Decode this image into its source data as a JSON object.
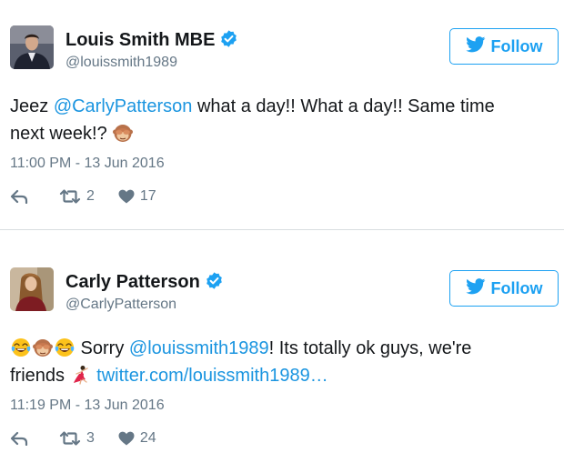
{
  "tweets": [
    {
      "author_name": "Louis Smith MBE",
      "handle": "@louissmith1989",
      "verified": true,
      "follow_label": "Follow",
      "body": {
        "prefix": "Jeez ",
        "mention": "@CarlyPatterson",
        "line1_rest": " what a day!! What a day!! Same time",
        "line2": "next week!? ",
        "emoji": "see-no-evil-monkey"
      },
      "timestamp": "11:00 PM - 13 Jun 2016",
      "retweets": "2",
      "likes": "17"
    },
    {
      "author_name": "Carly Patterson",
      "handle": "@CarlyPatterson",
      "verified": true,
      "follow_label": "Follow",
      "body": {
        "lead_emoji": [
          "tears-of-joy",
          "see-no-evil-monkey",
          "tears-of-joy"
        ],
        "prefix": " Sorry ",
        "mention": "@louissmith1989",
        "line1_rest": "! Its totally ok guys, we're",
        "line2": "friends ",
        "emoji": "dancer",
        "link": " twitter.com/louissmith1989…"
      },
      "timestamp": "11:19 PM - 13 Jun 2016",
      "retweets": "3",
      "likes": "24"
    }
  ],
  "colors": {
    "accent": "#1da1f2",
    "link": "#1b95e0",
    "muted": "#657786",
    "text": "#14171a"
  }
}
